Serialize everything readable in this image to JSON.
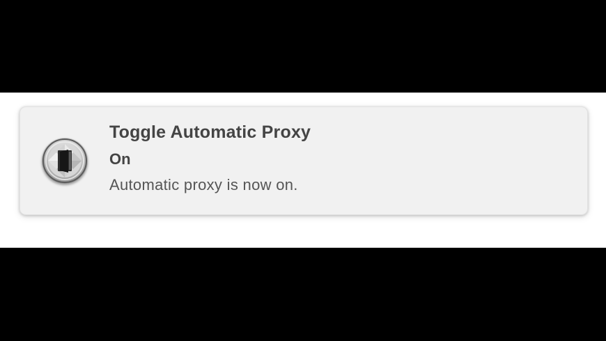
{
  "notification": {
    "icon": "proxy-door-icon",
    "title": "Toggle Automatic Proxy",
    "subtitle": "On",
    "message": "Automatic proxy is now on."
  },
  "colors": {
    "backdrop": "#000000",
    "screen": "#ffffff",
    "notification_bg": "#f1f1f1",
    "text_primary": "#444444",
    "text_secondary": "#555555"
  }
}
